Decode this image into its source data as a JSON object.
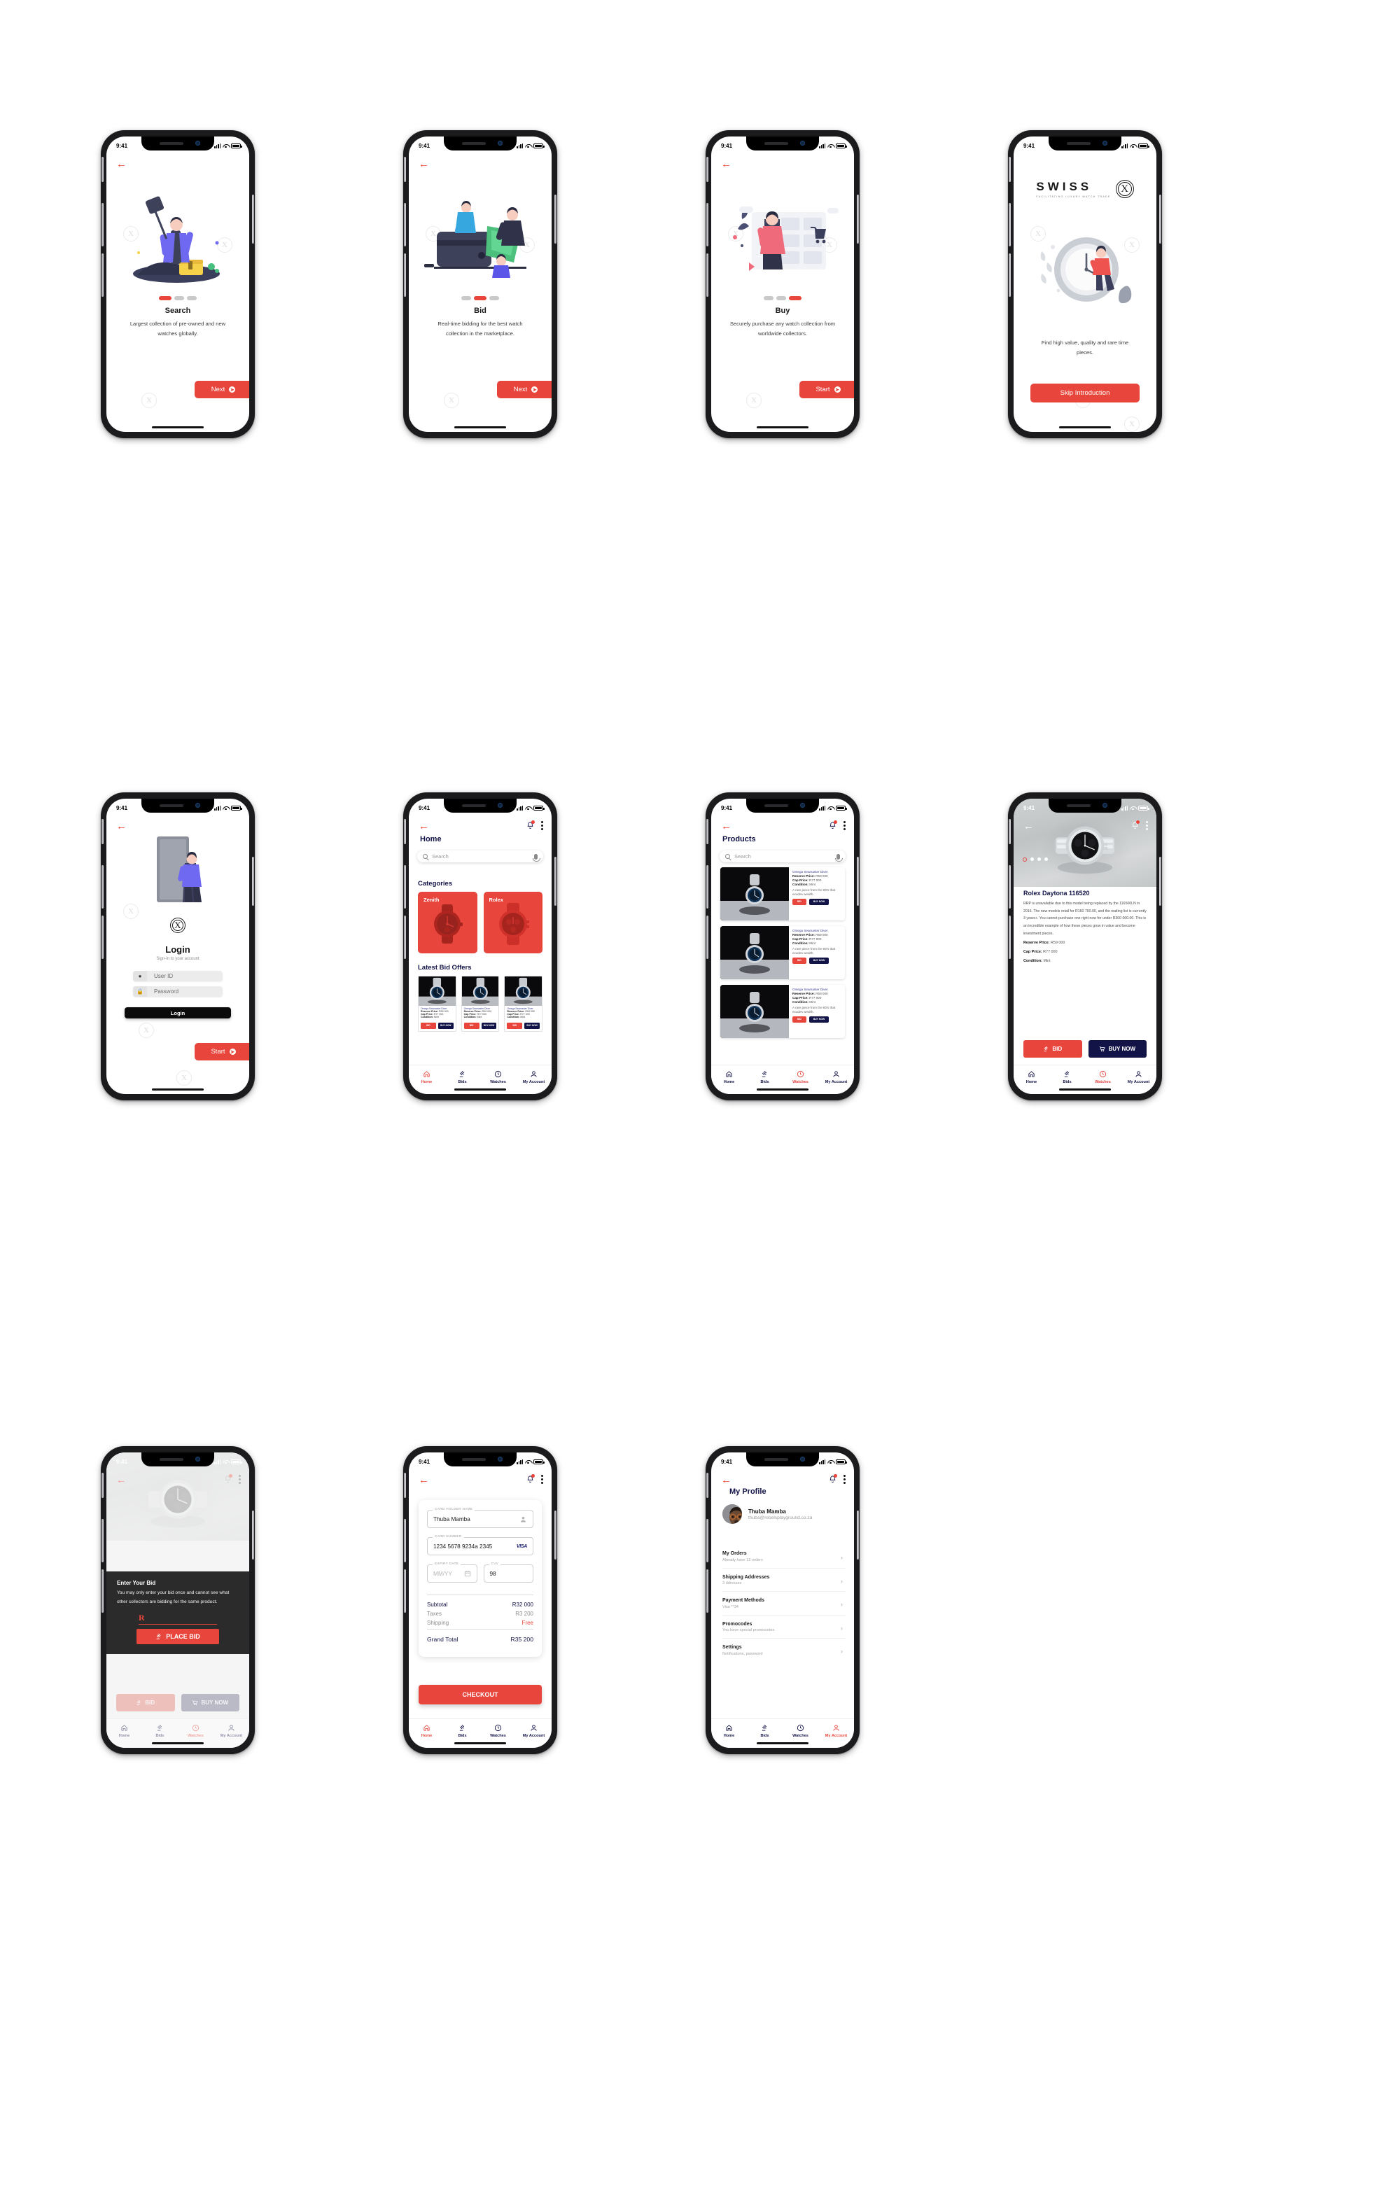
{
  "status_bar": {
    "time": "9:41"
  },
  "brand": {
    "name": "SWISS",
    "mark": "X",
    "tagline": "FACILITATING LUXURY WATCH TRADE",
    "accent": "#e8453c",
    "navy": "#121347",
    "dark": "#2b2b2b"
  },
  "onboarding": [
    {
      "title": "Search",
      "desc": "Largest collection of pre-owned and new watches globally.",
      "cta": "Next",
      "active_dot": 0
    },
    {
      "title": "Bid",
      "desc": "Real-time bidding for the best watch collection in the marketplace.",
      "cta": "Next",
      "active_dot": 1
    },
    {
      "title": "Buy",
      "desc": "Securely purchase any watch collection from worldwide collectors.",
      "cta": "Start",
      "active_dot": 2
    }
  ],
  "splash": {
    "desc": "Find high value, quality and rare time pieces.",
    "cta": "Skip Introduction"
  },
  "login": {
    "title": "Login",
    "subtitle": "Sign-in to your account",
    "user_placeholder": "User ID",
    "password_placeholder": "Password",
    "submit": "Login",
    "start": "Start"
  },
  "home": {
    "title": "Home",
    "search_placeholder": "Search",
    "categories_heading": "Categories",
    "categories": [
      {
        "name": "Zenith"
      },
      {
        "name": "Rolex"
      }
    ],
    "latest_heading": "Latest Bid Offers",
    "mini_cards": [
      {
        "name": "Omega Seamaster Diver",
        "reserve_label": "Reserve Price:",
        "reserve": "R59 000",
        "cap_label": "Cap Price:",
        "cap": "R77 000",
        "condition_label": "Condition:",
        "condition": "Mint",
        "bid": "BID",
        "buy": "BUY NOW"
      },
      {
        "name": "Omega Seamaster Diver",
        "reserve_label": "Reserve Price:",
        "reserve": "R59 000",
        "cap_label": "Cap Price:",
        "cap": "R77 000",
        "condition_label": "Condition:",
        "condition": "Mint",
        "bid": "BID",
        "buy": "BUY NOW"
      },
      {
        "name": "Omega Seamaster Diver",
        "reserve_label": "Reserve Price:",
        "reserve": "R59 000",
        "cap_label": "Cap Price:",
        "cap": "R77 000",
        "condition_label": "Condition:",
        "condition": "Mint",
        "bid": "BID",
        "buy": "BUY NOW"
      }
    ]
  },
  "products": {
    "title": "Products",
    "search_placeholder": "Search",
    "items": [
      {
        "name": "Omega Seamaster Diver",
        "reserve_label": "Reserve Price:",
        "reserve": "R59 000",
        "cap_label": "Cap Price:",
        "cap": "R77 000",
        "condition_label": "Condition:",
        "condition": "Mint",
        "desc": "A rare piece from the 80's that exudes wealth.",
        "bid": "BID",
        "buy": "BUY NOW"
      },
      {
        "name": "Omega Seamaster Diver",
        "reserve_label": "Reserve Price:",
        "reserve": "R59 000",
        "cap_label": "Cap Price:",
        "cap": "R77 000",
        "condition_label": "Condition:",
        "condition": "Mint",
        "desc": "A rare piece from the 80's that exudes wealth.",
        "bid": "BID",
        "buy": "BUY NOW"
      },
      {
        "name": "Omega Seamaster Diver",
        "reserve_label": "Reserve Price:",
        "reserve": "R59 000",
        "cap_label": "Cap Price:",
        "cap": "R77 000",
        "condition_label": "Condition:",
        "condition": "Mint",
        "desc": "A rare piece from the 80's that exudes wealth.",
        "bid": "BID",
        "buy": "BUY NOW"
      }
    ]
  },
  "detail": {
    "title": "Rolex Daytona 116520",
    "description": "RRP is unavailable due to this model being replaced by the 116500LN in 2016. The new models retail for R160 700.00, and the waiting list is currently 3 years+.  You cannot purchase one right now for under R300 000.00.   This is an incredible example of how these pieces grow in value and become investment pieces.",
    "reserve_label": "Reserve Price:",
    "reserve": "R59 000",
    "cap_label": "Cap Price:",
    "cap": "R77 000",
    "condition_label": "Condition:",
    "condition": "Mint",
    "bid": "BID",
    "buy": "BUY NOW",
    "carousel_count": 4,
    "carousel_active": 0
  },
  "bid_modal": {
    "heading": "Enter Your Bid",
    "body": "You may only enter your bid once and cannot see what other collectors are bidding for the same product.",
    "input_value": "R",
    "cta": "PLACE BID"
  },
  "checkout": {
    "card_holder_label": "CARD HOLDER NAME",
    "card_holder_value": "Thuba Mamba",
    "card_number_label": "CARD NUMBER",
    "card_number_value": "1234 5678 9234a 2345",
    "card_brand": "VISA",
    "expiry_label": "EXPIRY DATE",
    "expiry_placeholder": "MM/YY",
    "cvv_label": "CVV",
    "cvv_value": "98",
    "totals": [
      {
        "label": "Subtotal",
        "value": "R32 000",
        "strong": true
      },
      {
        "label": "Taxes",
        "value": "R3 200",
        "strong": false
      },
      {
        "label": "Shipping",
        "value": "Free",
        "strong": false,
        "accent": true
      }
    ],
    "grand_total_label": "Grand Total",
    "grand_total_value": "R35 200",
    "cta": "CHECKOUT"
  },
  "profile": {
    "title": "My Profile",
    "name": "Thuba Mamba",
    "email": "thuba@rebelsplayground.co.za",
    "rows": [
      {
        "title": "My Orders",
        "sub": "Already have 12 orders"
      },
      {
        "title": "Shipping Addresses",
        "sub": "3 ddresses"
      },
      {
        "title": "Payment Methods",
        "sub": "Visa  **34"
      },
      {
        "title": "Promocodes",
        "sub": "You have special promocodes"
      },
      {
        "title": "Settings",
        "sub": "Notifications, password"
      }
    ]
  },
  "tabs": [
    {
      "label": "Home",
      "icon": "home-icon"
    },
    {
      "label": "Bids",
      "icon": "gavel-icon"
    },
    {
      "label": "Watches",
      "icon": "clock-icon"
    },
    {
      "label": "My Account",
      "icon": "person-icon"
    }
  ]
}
